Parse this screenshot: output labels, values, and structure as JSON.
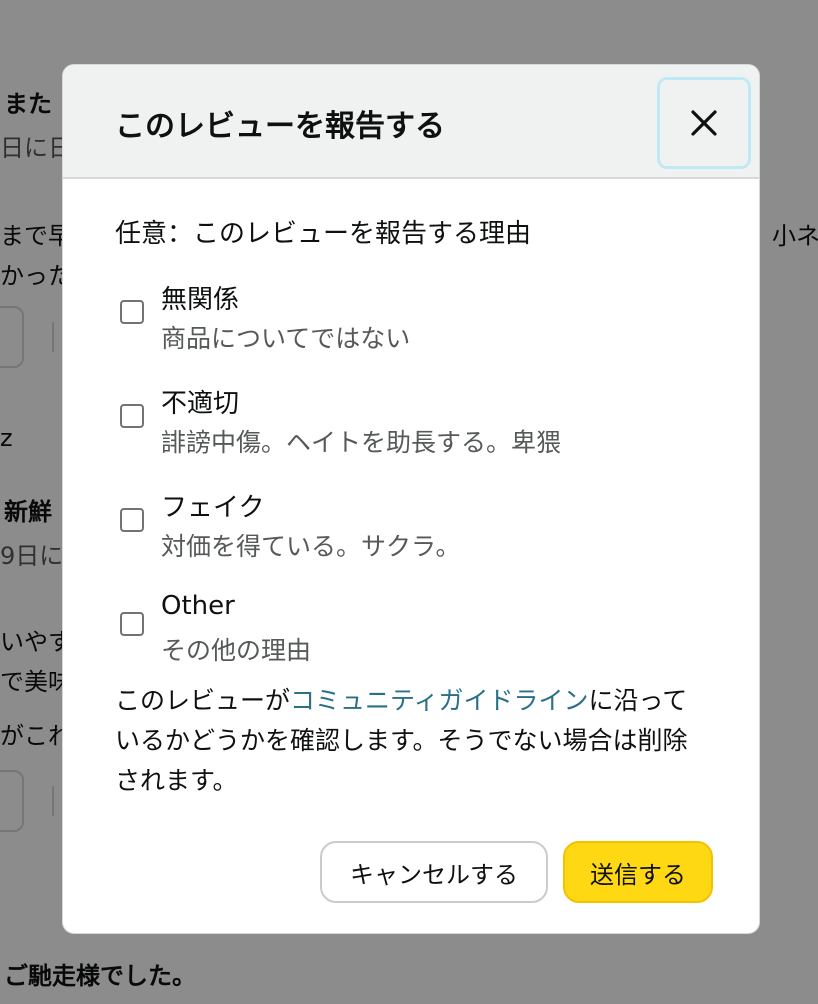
{
  "background": {
    "texts": [
      {
        "text": "また"
      },
      {
        "text": "日に日"
      },
      {
        "text": "まで早"
      },
      {
        "text": "かった"
      },
      {
        "text": "小ネ"
      },
      {
        "text": "z"
      },
      {
        "text": "新鮮"
      },
      {
        "text": "9日に"
      },
      {
        "text": "いやす"
      },
      {
        "text": "で美味"
      },
      {
        "text": "がこれ"
      },
      {
        "text": "ご馳走様でした。"
      }
    ]
  },
  "modal": {
    "title": "このレビューを報告する",
    "close_icon": "close-icon",
    "prompt": "任意：このレビューを報告する理由",
    "options": [
      {
        "label": "無関係",
        "description": "商品についてではない",
        "checked": false
      },
      {
        "label": "不適切",
        "description": "誹謗中傷。ヘイトを助長する。卑猥",
        "checked": false
      },
      {
        "label": "フェイク",
        "description": "対価を得ている。サクラ。",
        "checked": false
      },
      {
        "label": "Other",
        "description": "その他の理由",
        "checked": false
      }
    ],
    "notice": {
      "before": "このレビューが",
      "link": "コミュニティガイドライン",
      "after": "に沿っているかどうかを確認します。そうでない場合は削除されます。"
    },
    "cancel_label": "キャンセルする",
    "submit_label": "送信する"
  },
  "colors": {
    "overlay": "rgba(0,0,0,0.45)",
    "header_bg": "#f0f2f2",
    "link": "#2a7089",
    "submit_bg": "#ffd814",
    "close_focus_ring": "#bfeaf5"
  }
}
